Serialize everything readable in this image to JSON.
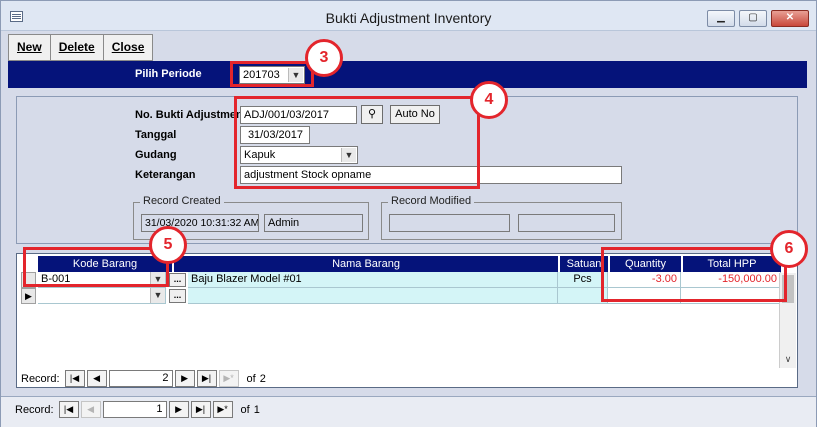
{
  "window": {
    "title": "Bukti Adjustment Inventory",
    "controls": {
      "minimize": "▁",
      "maximize": "▢",
      "close": "✕"
    }
  },
  "toolbar": {
    "new_label": "New",
    "delete_label": "Delete",
    "close_label": "Close"
  },
  "period": {
    "label": "Pilih Periode",
    "value": "201703"
  },
  "form": {
    "no_bukti_label": "No. Bukti Adjustment",
    "no_bukti_value": "ADJ/001/03/2017",
    "auto_no_label": "Auto No",
    "tanggal_label": "Tanggal",
    "tanggal_value": "31/03/2017",
    "gudang_label": "Gudang",
    "gudang_value": "Kapuk",
    "keterangan_label": "Keterangan",
    "keterangan_value": "adjustment Stock opname"
  },
  "record_created": {
    "title": "Record Created",
    "datetime": "31/03/2020 10:31:32 AM",
    "user": "Admin"
  },
  "record_modified": {
    "title": "Record Modified",
    "datetime": "",
    "user": ""
  },
  "annotations": {
    "b3": "3",
    "b4": "4",
    "b5": "5",
    "b6": "6",
    "color": "#e3252c"
  },
  "grid": {
    "headers": {
      "kode": "Kode Barang",
      "nama": "Nama Barang",
      "satuan": "Satuan",
      "qty": "Quantity",
      "hpp": "Total HPP"
    },
    "rows": [
      {
        "kode": "B-001",
        "nama": "Baju Blazer Model #01",
        "satuan": "Pcs",
        "qty": "-3.00",
        "hpp": "-150,000.00"
      }
    ]
  },
  "subnav": {
    "label": "Record:",
    "current": "2",
    "of": "of",
    "total": "2"
  },
  "mainnav": {
    "label": "Record:",
    "current": "1",
    "of": "of",
    "total": "1"
  },
  "colors": {
    "header_band": "#05137a",
    "form_bg": "#d6dbe9",
    "grid_row": "#d4f5f7",
    "negative": "#e3252c"
  }
}
